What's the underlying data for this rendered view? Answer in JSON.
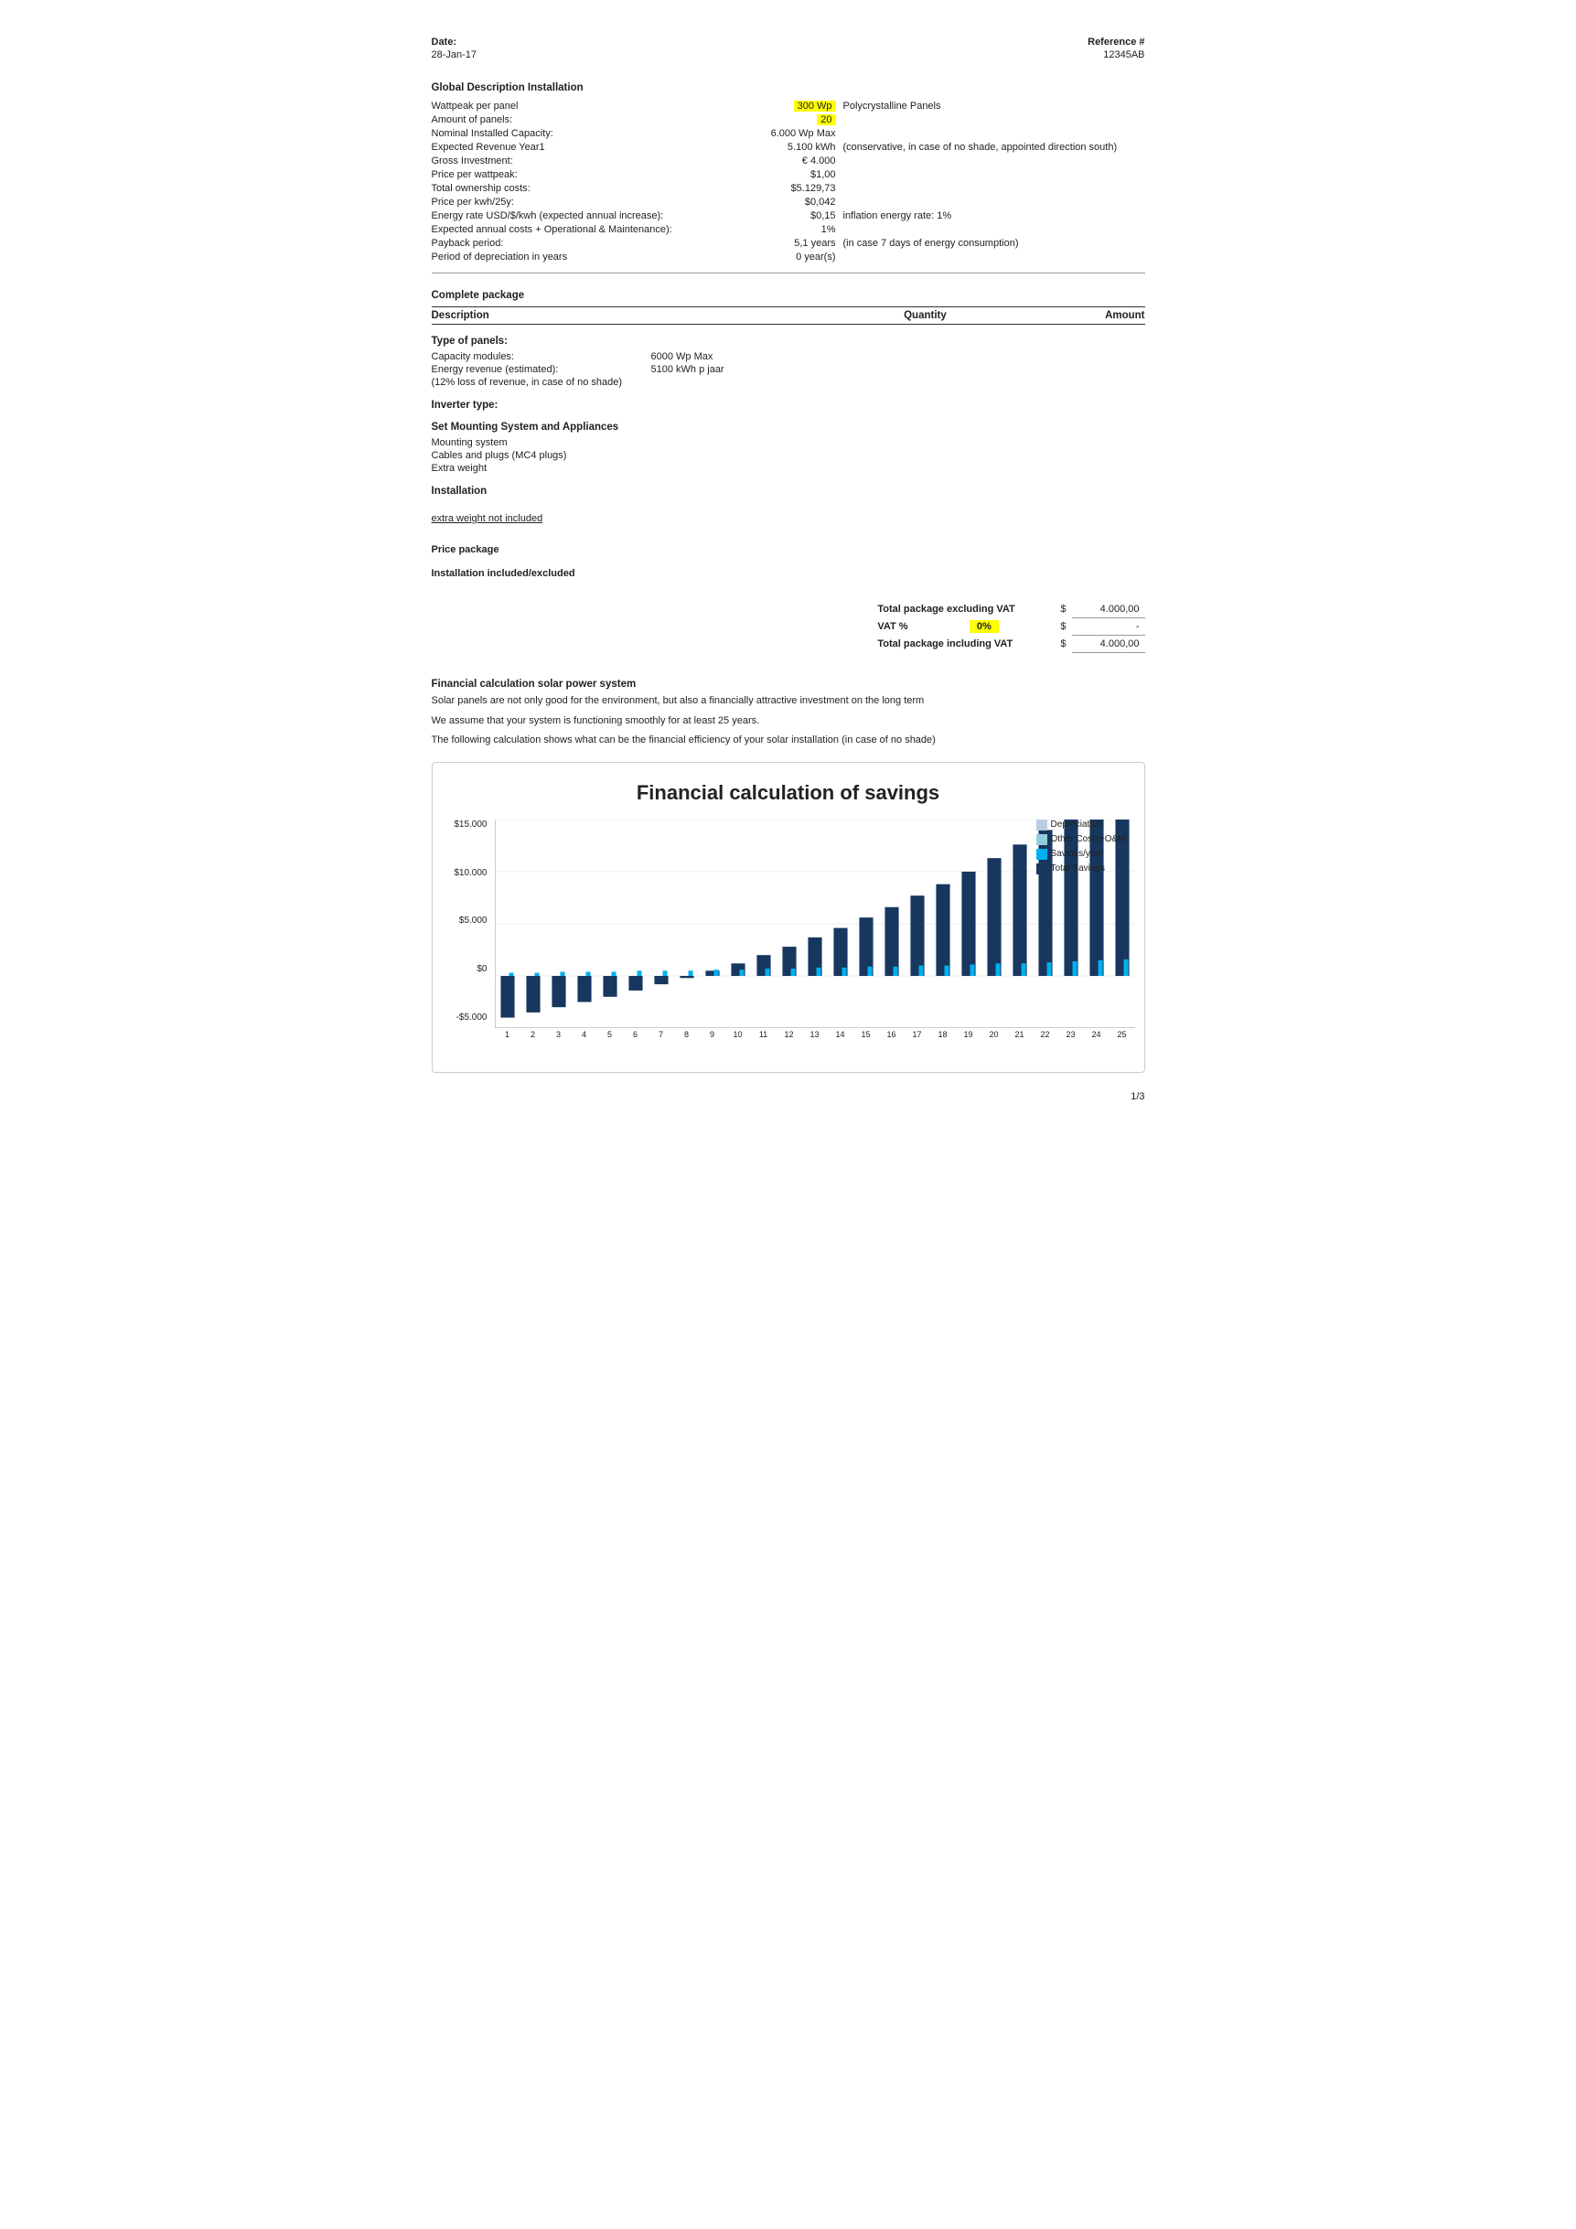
{
  "header": {
    "date_label": "Date:",
    "date_value": "28-Jan-17",
    "reference_label": "Reference #",
    "reference_value": "12345AB"
  },
  "global_description": {
    "title": "Global Description Installation",
    "rows": [
      {
        "label": "Wattpeak per panel",
        "value": "300 Wp",
        "note": "Polycrystalline Panels",
        "highlight": true
      },
      {
        "label": "Amount of panels:",
        "value": "20",
        "note": "",
        "highlight": true
      },
      {
        "label": "Nominal Installed Capacity:",
        "value": "6.000 Wp Max",
        "note": ""
      },
      {
        "label": "Expected Revenue Year1",
        "value": "5.100 kWh",
        "note": "(conservative, in case of no shade, appointed direction south)"
      },
      {
        "label": "Gross Investment:",
        "value": "€ 4.000",
        "note": ""
      },
      {
        "label": "Price per wattpeak:",
        "value": "$1,00",
        "note": ""
      },
      {
        "label": "Total ownership costs:",
        "value": "$5.129,73",
        "note": ""
      },
      {
        "label": "Price per kwh/25y:",
        "value": "$0,042",
        "note": ""
      },
      {
        "label": "Energy rate USD/$/kwh (expected annual increase):",
        "value": "$0,15",
        "note": "inflation energy rate:   1%"
      },
      {
        "label": "Expected annual costs + Operational & Maintenance):",
        "value": "1%",
        "note": ""
      },
      {
        "label": "Payback period:",
        "value": "5,1 years",
        "note": "(in case 7 days of energy consumption)"
      },
      {
        "label": "Period of depreciation in years",
        "value": "0 year(s)",
        "note": ""
      }
    ]
  },
  "complete_package": {
    "title": "Complete package",
    "col_description": "Description",
    "col_quantity": "Quantity",
    "col_amount": "Amount",
    "type_of_panels_title": "Type of panels:",
    "panel_rows": [
      {
        "label": "Capacity modules:",
        "value": "6000 Wp Max"
      },
      {
        "label": "Energy revenue (estimated):",
        "value": "5100 kWh p jaar"
      },
      {
        "label": "",
        "value": "(12% loss of revenue, in case of no shade)"
      }
    ],
    "inverter_title": "Inverter type:",
    "mounting_title": "Set Mounting System and Appliances",
    "mounting_rows": [
      "Mounting system",
      "Cables and plugs (MC4 plugs)",
      "Extra weight"
    ],
    "installation_title": "Installation",
    "extra_weight_note": "extra weight not included",
    "price_package_label": "Price package",
    "installation_included": "Installation included/excluded",
    "totals": {
      "excl_vat_label": "Total package excluding VAT",
      "excl_vat_amount": "4.000,00",
      "vat_label": "VAT %",
      "vat_pct": "0%",
      "vat_amount": "-",
      "incl_vat_label": "Total package including VAT",
      "incl_vat_amount": "4.000,00",
      "currency": "$"
    }
  },
  "financial": {
    "title": "Financial calculation solar power system",
    "lines": [
      "Solar panels are not only good for the environment, but also a financially attractive investment on the long term",
      "We assume that your system is functioning smoothly for at least 25 years.",
      "The following calculation shows what can be the financial efficiency of your solar installation (in case of no shade)"
    ],
    "chart_title": "Financial calculation of savings",
    "y_labels": [
      "$15.000",
      "$10.000",
      "$5.000",
      "$0",
      "-$5.000"
    ],
    "x_labels": [
      "1",
      "2",
      "3",
      "4",
      "5",
      "6",
      "7",
      "8",
      "9",
      "10",
      "11",
      "12",
      "13",
      "14",
      "15",
      "16",
      "17",
      "18",
      "19",
      "20",
      "21",
      "22",
      "23",
      "24",
      "25"
    ],
    "legend": [
      {
        "label": "Depreciation",
        "color": "#b8cce4"
      },
      {
        "label": "Other Costs+O&M",
        "color": "#92cddc"
      },
      {
        "label": "Savings/year",
        "color": "#00b0f0"
      },
      {
        "label": "Total Savings",
        "color": "#17375e"
      }
    ],
    "bar_data": [
      {
        "depreciation": 0,
        "other": 5,
        "savings": 3,
        "total": -40
      },
      {
        "depreciation": 0,
        "other": 5,
        "savings": 3,
        "total": -35
      },
      {
        "depreciation": 0,
        "other": 5,
        "savings": 4,
        "total": -30
      },
      {
        "depreciation": 0,
        "other": 5,
        "savings": 4,
        "total": -25
      },
      {
        "depreciation": 0,
        "other": 5,
        "savings": 4,
        "total": -20
      },
      {
        "depreciation": 0,
        "other": 5,
        "savings": 5,
        "total": -14
      },
      {
        "depreciation": 0,
        "other": 5,
        "savings": 5,
        "total": -8
      },
      {
        "depreciation": 0,
        "other": 5,
        "savings": 5,
        "total": -2
      },
      {
        "depreciation": 0,
        "other": 5,
        "savings": 6,
        "total": 5
      },
      {
        "depreciation": 0,
        "other": 5,
        "savings": 6,
        "total": 12
      },
      {
        "depreciation": 0,
        "other": 5,
        "savings": 7,
        "total": 20
      },
      {
        "depreciation": 0,
        "other": 5,
        "savings": 7,
        "total": 28
      },
      {
        "depreciation": 0,
        "other": 5,
        "savings": 8,
        "total": 37
      },
      {
        "depreciation": 0,
        "other": 5,
        "savings": 8,
        "total": 46
      },
      {
        "depreciation": 0,
        "other": 5,
        "savings": 9,
        "total": 56
      },
      {
        "depreciation": 0,
        "other": 5,
        "savings": 9,
        "total": 66
      },
      {
        "depreciation": 0,
        "other": 5,
        "savings": 10,
        "total": 77
      },
      {
        "depreciation": 0,
        "other": 5,
        "savings": 10,
        "total": 88
      },
      {
        "depreciation": 0,
        "other": 5,
        "savings": 11,
        "total": 100
      },
      {
        "depreciation": 0,
        "other": 5,
        "savings": 12,
        "total": 113
      },
      {
        "depreciation": 0,
        "other": 5,
        "savings": 12,
        "total": 126
      },
      {
        "depreciation": 0,
        "other": 5,
        "savings": 13,
        "total": 140
      },
      {
        "depreciation": 0,
        "other": 5,
        "savings": 14,
        "total": 155
      },
      {
        "depreciation": 0,
        "other": 5,
        "savings": 15,
        "total": 171
      },
      {
        "depreciation": 0,
        "other": 5,
        "savings": 16,
        "total": 188
      }
    ]
  },
  "page_number": "1/3"
}
